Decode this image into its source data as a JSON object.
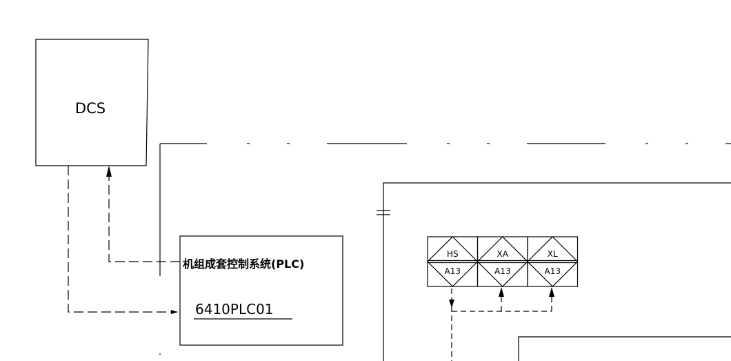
{
  "dcs_box": {
    "label": "DCS"
  },
  "plc_box": {
    "title": "机组成套控制系统(PLC)",
    "tag": "6410PLC01"
  },
  "instruments": [
    {
      "top": "HS",
      "bottom": "A13"
    },
    {
      "top": "XA",
      "bottom": "A13"
    },
    {
      "top": "XL",
      "bottom": "A13"
    }
  ]
}
